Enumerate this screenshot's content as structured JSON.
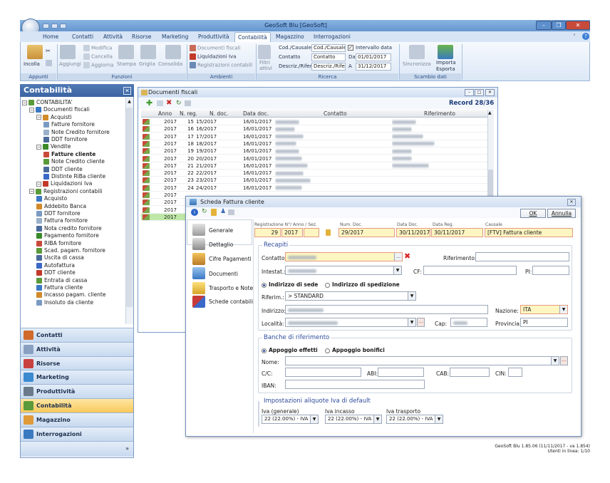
{
  "app": {
    "title": "GeoSoft Blu [GeoSoft]"
  },
  "menu": {
    "tabs": [
      "Home",
      "Contatti",
      "Attività",
      "Risorse",
      "Marketing",
      "Produttività",
      "Contabilità",
      "Magazzino",
      "Interrogazioni"
    ],
    "active": "Contabilità"
  },
  "ribbon": {
    "appunti": {
      "incolla": "Incolla",
      "label": "Appunti"
    },
    "funzioni": {
      "aggiungi": "Aggiungi",
      "modifica": "Modifica",
      "cancella": "Cancella",
      "aggiorna": "Aggiorna",
      "stampa": "Stampa",
      "griglia": "Griglia",
      "consolida": "Consolida",
      "label": "Funzioni"
    },
    "ambienti": {
      "documenti_fiscali": "Documenti fiscali",
      "liquidazioni_iva": "Liquidazioni Iva",
      "registrazioni_contabili": "Registrazioni contabili",
      "label": "Ambienti"
    },
    "ricerca": {
      "filtri": "Filtri attivi",
      "cod_causale_label": "Cod./Causale",
      "cod_causale_value": "Cod./Causale",
      "contatto_label": "Contatto",
      "contatto_value": "Contatto",
      "descriz_label": "Descriz./Rifer.",
      "descriz_value": "Descriz./Rifer",
      "intervallo": "Intervallo data",
      "da_label": "Da",
      "da_value": "01/01/2017",
      "a_label": "A",
      "a_value": "31/12/2017",
      "label": "Ricerca"
    },
    "scambio": {
      "sincronizza": "Sincronizza",
      "importa": "Importa",
      "esporta": "Esporta",
      "label": "Scambio dati"
    }
  },
  "left_panel": {
    "title": "Contabilità",
    "tree": [
      {
        "label": "CONTABILITA'",
        "level": 0
      },
      {
        "label": "Documenti fiscali",
        "level": 1
      },
      {
        "label": "Acquisti",
        "level": 2
      },
      {
        "label": "Fatture fornitore",
        "level": 3
      },
      {
        "label": "Note Credito fornitore",
        "level": 3
      },
      {
        "label": "DDT fornitore",
        "level": 3
      },
      {
        "label": "Vendite",
        "level": 2
      },
      {
        "label": "Fatture cliente",
        "level": 3,
        "bold": true
      },
      {
        "label": "Note Credito cliente",
        "level": 3
      },
      {
        "label": "DDT cliente",
        "level": 3
      },
      {
        "label": "Distinte RiBa cliente",
        "level": 3
      },
      {
        "label": "Liquidazioni Iva",
        "level": 2
      },
      {
        "label": "Registrazioni contabili",
        "level": 1
      },
      {
        "label": "Acquisto",
        "level": 2
      },
      {
        "label": "Addebito Banca",
        "level": 2
      },
      {
        "label": "DDT fornitore",
        "level": 2
      },
      {
        "label": "Fattura fornitore",
        "level": 2
      },
      {
        "label": "Nota credito fornitore",
        "level": 2
      },
      {
        "label": "Pagamento fornitore",
        "level": 2
      },
      {
        "label": "RIBA fornitore",
        "level": 2
      },
      {
        "label": "Scad. pagam. fornitore",
        "level": 2
      },
      {
        "label": "Uscita di cassa",
        "level": 2
      },
      {
        "label": "Autofattura",
        "level": 2
      },
      {
        "label": "DDT cliente",
        "level": 2
      },
      {
        "label": "Entrata di cassa",
        "level": 2
      },
      {
        "label": "Fattura cliente",
        "level": 2
      },
      {
        "label": "Incasso pagam. cliente",
        "level": 2
      },
      {
        "label": "Insoluto da cliente",
        "level": 2
      }
    ],
    "nav": [
      {
        "label": "Contatti",
        "color": "#d06a2a"
      },
      {
        "label": "Attività",
        "color": "#8aa0c0"
      },
      {
        "label": "Risorse",
        "color": "#c84040"
      },
      {
        "label": "Marketing",
        "color": "#3c8ad0"
      },
      {
        "label": "Produttività",
        "color": "#6a7a8a"
      },
      {
        "label": "Contabilità",
        "color": "#5a9a3a"
      },
      {
        "label": "Magazzino",
        "color": "#e09a3a"
      },
      {
        "label": "Interrogazioni",
        "color": "#3a7ac0"
      }
    ],
    "active_nav": "Contabilità"
  },
  "docs": {
    "title": "Documenti fiscali",
    "record": "Record 28/36",
    "columns": [
      "Anno",
      "N. reg.",
      "N. doc.",
      "Data doc.",
      "Contatto",
      "Riferimento"
    ],
    "rows": [
      {
        "anno": "2017",
        "nreg": "15",
        "ndoc": "15/2017",
        "data": "16/01/2017"
      },
      {
        "anno": "2017",
        "nreg": "16",
        "ndoc": "16/2017",
        "data": "16/01/2017"
      },
      {
        "anno": "2017",
        "nreg": "17",
        "ndoc": "17/2017",
        "data": "16/01/2017"
      },
      {
        "anno": "2017",
        "nreg": "18",
        "ndoc": "18/2017",
        "data": "16/01/2017"
      },
      {
        "anno": "2017",
        "nreg": "19",
        "ndoc": "19/2017",
        "data": "16/01/2017"
      },
      {
        "anno": "2017",
        "nreg": "20",
        "ndoc": "20/2017",
        "data": "16/01/2017"
      },
      {
        "anno": "2017",
        "nreg": "21",
        "ndoc": "21/2017",
        "data": "16/01/2017"
      },
      {
        "anno": "2017",
        "nreg": "22",
        "ndoc": "22/2017",
        "data": "16/01/2017"
      },
      {
        "anno": "2017",
        "nreg": "23",
        "ndoc": "23/2017",
        "data": "16/01/2017"
      },
      {
        "anno": "2017",
        "nreg": "24",
        "ndoc": "24/2017",
        "data": "16/01/2017"
      },
      {
        "anno": "2017",
        "nreg": "",
        "ndoc": "",
        "data": ""
      },
      {
        "anno": "2017",
        "nreg": "",
        "ndoc": "",
        "data": ""
      },
      {
        "anno": "2017",
        "nreg": "",
        "ndoc": "",
        "data": ""
      },
      {
        "anno": "2017",
        "nreg": "",
        "ndoc": "",
        "data": ""
      }
    ]
  },
  "dialog": {
    "title": "Scheda Fattura cliente",
    "ok": "OK",
    "annulla": "Annulla",
    "side": [
      "Generale",
      "Dettaglio",
      "Cifre Pagamenti",
      "Documenti",
      "Trasporto e Note",
      "Schede contabili"
    ],
    "header": {
      "reg_label": "Registrazione N°/ Anno / Sez.",
      "num_doc_label": "Num. Doc.",
      "data_doc_label": "Data Doc.",
      "data_reg_label": "Data Reg.",
      "causale_label": "Causale",
      "reg_num": "29",
      "anno": "2017",
      "num_doc": "29/2017",
      "data_doc": "30/11/2017",
      "data_reg": "30/11/2017",
      "causale": "[FTV] Fattura cliente"
    },
    "recapiti": {
      "title": "Recapiti",
      "contatto": "Contatto:",
      "riferimento": "Riferimento:",
      "intestat": "Intestat.:",
      "cf": "CF:",
      "pi": "PI:",
      "indirizzo_sede": "Indirizzo di sede",
      "indirizzo_spedizione": "Indirizzo di spedizione",
      "riferim": "Riferim.:",
      "riferim_value": "> STANDARD",
      "indirizzo": "Indirizzo:",
      "nazione": "Nazione:",
      "nazione_value": "ITA",
      "localita": "Località:",
      "cap": "Cap:",
      "provincia": "Provincia:",
      "provincia_value": "PI"
    },
    "banche": {
      "title": "Banche di riferimento",
      "appoggio_effetti": "Appoggio effetti",
      "appoggio_bonifici": "Appoggio bonifici",
      "nome": "Nome:",
      "cc": "C/C:",
      "abi": "ABI:",
      "cab": "CAB:",
      "cin": "CIN:",
      "iban": "IBAN:"
    },
    "iva": {
      "title": "Impostazioni aliquote Iva di default",
      "generale_label": "Iva (generale)",
      "incasso_label": "Iva incasso",
      "trasporto_label": "Iva trasporto",
      "generale": "22 (22.00%) - IVA",
      "incasso": "22 (22.00%) - IVA",
      "trasporto": "22 (22.00%) - IVA"
    }
  },
  "footer": {
    "version": "GeoSoft Blu 1.85.06 (11/11/2017 - va 1.854)",
    "utenti": "Utenti in linea: 1/10"
  }
}
